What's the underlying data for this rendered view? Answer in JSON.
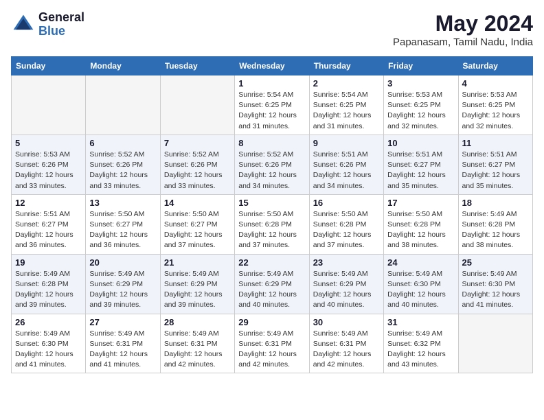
{
  "header": {
    "logo_general": "General",
    "logo_blue": "Blue",
    "month_year": "May 2024",
    "location": "Papanasam, Tamil Nadu, India"
  },
  "days_of_week": [
    "Sunday",
    "Monday",
    "Tuesday",
    "Wednesday",
    "Thursday",
    "Friday",
    "Saturday"
  ],
  "weeks": [
    [
      {
        "day": "",
        "info": ""
      },
      {
        "day": "",
        "info": ""
      },
      {
        "day": "",
        "info": ""
      },
      {
        "day": "1",
        "info": "Sunrise: 5:54 AM\nSunset: 6:25 PM\nDaylight: 12 hours\nand 31 minutes."
      },
      {
        "day": "2",
        "info": "Sunrise: 5:54 AM\nSunset: 6:25 PM\nDaylight: 12 hours\nand 31 minutes."
      },
      {
        "day": "3",
        "info": "Sunrise: 5:53 AM\nSunset: 6:25 PM\nDaylight: 12 hours\nand 32 minutes."
      },
      {
        "day": "4",
        "info": "Sunrise: 5:53 AM\nSunset: 6:25 PM\nDaylight: 12 hours\nand 32 minutes."
      }
    ],
    [
      {
        "day": "5",
        "info": "Sunrise: 5:53 AM\nSunset: 6:26 PM\nDaylight: 12 hours\nand 33 minutes."
      },
      {
        "day": "6",
        "info": "Sunrise: 5:52 AM\nSunset: 6:26 PM\nDaylight: 12 hours\nand 33 minutes."
      },
      {
        "day": "7",
        "info": "Sunrise: 5:52 AM\nSunset: 6:26 PM\nDaylight: 12 hours\nand 33 minutes."
      },
      {
        "day": "8",
        "info": "Sunrise: 5:52 AM\nSunset: 6:26 PM\nDaylight: 12 hours\nand 34 minutes."
      },
      {
        "day": "9",
        "info": "Sunrise: 5:51 AM\nSunset: 6:26 PM\nDaylight: 12 hours\nand 34 minutes."
      },
      {
        "day": "10",
        "info": "Sunrise: 5:51 AM\nSunset: 6:27 PM\nDaylight: 12 hours\nand 35 minutes."
      },
      {
        "day": "11",
        "info": "Sunrise: 5:51 AM\nSunset: 6:27 PM\nDaylight: 12 hours\nand 35 minutes."
      }
    ],
    [
      {
        "day": "12",
        "info": "Sunrise: 5:51 AM\nSunset: 6:27 PM\nDaylight: 12 hours\nand 36 minutes."
      },
      {
        "day": "13",
        "info": "Sunrise: 5:50 AM\nSunset: 6:27 PM\nDaylight: 12 hours\nand 36 minutes."
      },
      {
        "day": "14",
        "info": "Sunrise: 5:50 AM\nSunset: 6:27 PM\nDaylight: 12 hours\nand 37 minutes."
      },
      {
        "day": "15",
        "info": "Sunrise: 5:50 AM\nSunset: 6:28 PM\nDaylight: 12 hours\nand 37 minutes."
      },
      {
        "day": "16",
        "info": "Sunrise: 5:50 AM\nSunset: 6:28 PM\nDaylight: 12 hours\nand 37 minutes."
      },
      {
        "day": "17",
        "info": "Sunrise: 5:50 AM\nSunset: 6:28 PM\nDaylight: 12 hours\nand 38 minutes."
      },
      {
        "day": "18",
        "info": "Sunrise: 5:49 AM\nSunset: 6:28 PM\nDaylight: 12 hours\nand 38 minutes."
      }
    ],
    [
      {
        "day": "19",
        "info": "Sunrise: 5:49 AM\nSunset: 6:28 PM\nDaylight: 12 hours\nand 39 minutes."
      },
      {
        "day": "20",
        "info": "Sunrise: 5:49 AM\nSunset: 6:29 PM\nDaylight: 12 hours\nand 39 minutes."
      },
      {
        "day": "21",
        "info": "Sunrise: 5:49 AM\nSunset: 6:29 PM\nDaylight: 12 hours\nand 39 minutes."
      },
      {
        "day": "22",
        "info": "Sunrise: 5:49 AM\nSunset: 6:29 PM\nDaylight: 12 hours\nand 40 minutes."
      },
      {
        "day": "23",
        "info": "Sunrise: 5:49 AM\nSunset: 6:29 PM\nDaylight: 12 hours\nand 40 minutes."
      },
      {
        "day": "24",
        "info": "Sunrise: 5:49 AM\nSunset: 6:30 PM\nDaylight: 12 hours\nand 40 minutes."
      },
      {
        "day": "25",
        "info": "Sunrise: 5:49 AM\nSunset: 6:30 PM\nDaylight: 12 hours\nand 41 minutes."
      }
    ],
    [
      {
        "day": "26",
        "info": "Sunrise: 5:49 AM\nSunset: 6:30 PM\nDaylight: 12 hours\nand 41 minutes."
      },
      {
        "day": "27",
        "info": "Sunrise: 5:49 AM\nSunset: 6:31 PM\nDaylight: 12 hours\nand 41 minutes."
      },
      {
        "day": "28",
        "info": "Sunrise: 5:49 AM\nSunset: 6:31 PM\nDaylight: 12 hours\nand 42 minutes."
      },
      {
        "day": "29",
        "info": "Sunrise: 5:49 AM\nSunset: 6:31 PM\nDaylight: 12 hours\nand 42 minutes."
      },
      {
        "day": "30",
        "info": "Sunrise: 5:49 AM\nSunset: 6:31 PM\nDaylight: 12 hours\nand 42 minutes."
      },
      {
        "day": "31",
        "info": "Sunrise: 5:49 AM\nSunset: 6:32 PM\nDaylight: 12 hours\nand 43 minutes."
      },
      {
        "day": "",
        "info": ""
      }
    ]
  ]
}
